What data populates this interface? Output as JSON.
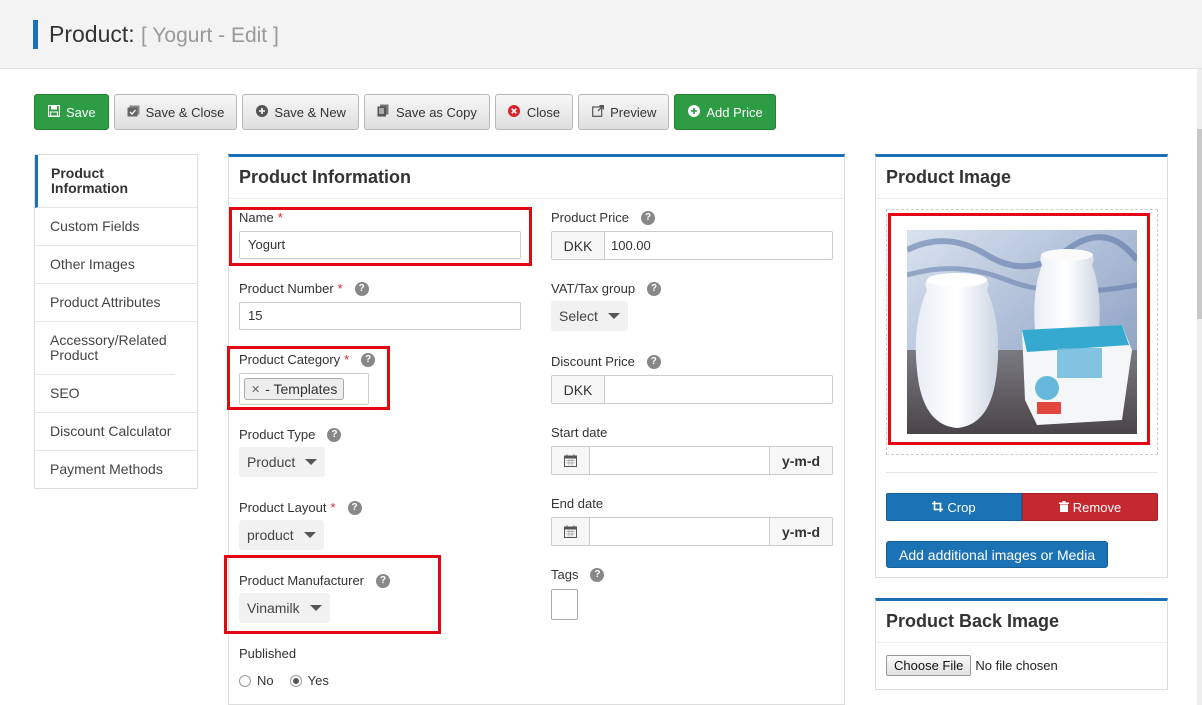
{
  "header": {
    "title_main": "Product:",
    "title_sub": "[ Yogurt - Edit ]"
  },
  "toolbar": {
    "save": "Save",
    "save_close": "Save & Close",
    "save_new": "Save & New",
    "save_copy": "Save as Copy",
    "close": "Close",
    "preview": "Preview",
    "add_price": "Add Price"
  },
  "sidebar": {
    "items": [
      {
        "label": "Product Information"
      },
      {
        "label": "Custom Fields"
      },
      {
        "label": "Other Images"
      },
      {
        "label": "Product Attributes"
      },
      {
        "label": "Accessory/Related Product"
      },
      {
        "label": "SEO"
      },
      {
        "label": "Discount Calculator"
      },
      {
        "label": "Payment Methods"
      }
    ]
  },
  "info": {
    "title": "Product Information",
    "name_label": "Name",
    "name_value": "Yogurt",
    "number_label": "Product Number",
    "number_value": "15",
    "category_label": "Product Category",
    "category_chip": "- Templates",
    "type_label": "Product Type",
    "type_value": "Product",
    "layout_label": "Product Layout",
    "layout_value": "product",
    "manufacturer_label": "Product Manufacturer",
    "manufacturer_value": "Vinamilk",
    "published_label": "Published",
    "published_no": "No",
    "published_yes": "Yes",
    "price_label": "Product Price",
    "currency": "DKK",
    "price_value": "100.00",
    "vat_label": "VAT/Tax group",
    "vat_value": "Select",
    "discount_label": "Discount Price",
    "discount_currency": "DKK",
    "start_label": "Start date",
    "end_label": "End date",
    "date_format": "y-m-d",
    "tags_label": "Tags",
    "required_mark": "*"
  },
  "image_panel": {
    "title": "Product Image",
    "crop": "Crop",
    "remove": "Remove",
    "add_media": "Add additional images or Media"
  },
  "back_image": {
    "title": "Product Back Image",
    "choose_file": "Choose File",
    "no_file": "No file chosen"
  },
  "colors": {
    "accent": "#1a6fb5",
    "green": "#2e9b45",
    "danger": "#c52930",
    "highlight": "#e30613"
  }
}
